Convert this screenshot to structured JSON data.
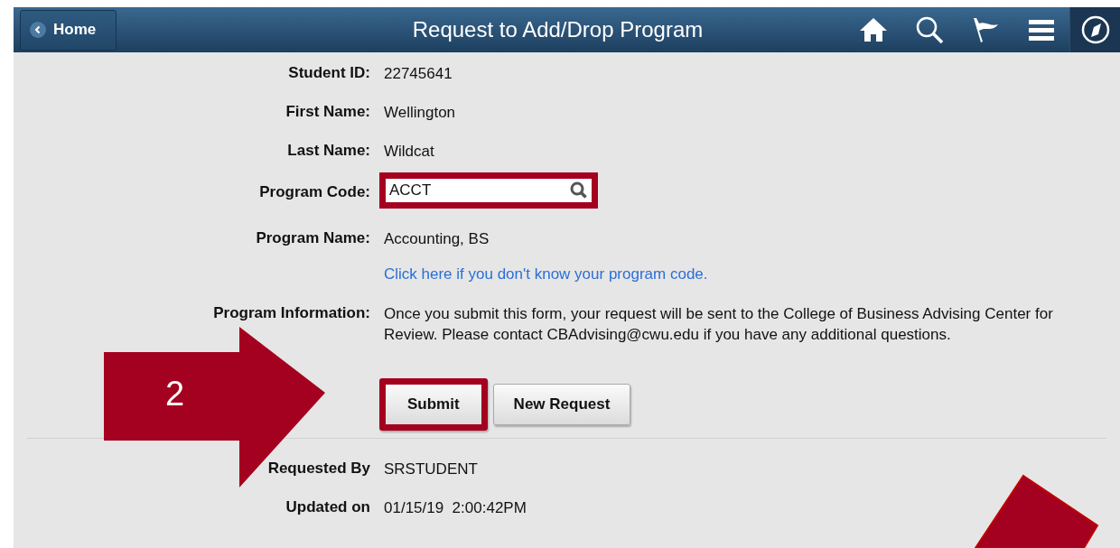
{
  "header": {
    "back_button": "Home",
    "title": "Request to Add/Drop Program"
  },
  "fields": [
    {
      "kind": "text",
      "label": "Student ID:",
      "value": "22745641"
    },
    {
      "kind": "text",
      "label": "First Name:",
      "value": "Wellington"
    },
    {
      "kind": "text",
      "label": "Last Name:",
      "value": "Wildcat"
    },
    {
      "kind": "input",
      "label": "Program Code:",
      "value": "ACCT",
      "highlighted": true
    },
    {
      "kind": "text",
      "label": "Program Name:",
      "value": "Accounting, BS"
    },
    {
      "kind": "link",
      "value": "Click here if you don't know your program code."
    },
    {
      "kind": "text",
      "label": "Program Information:",
      "value": "Once you submit this form, your request will be sent to the College of Business Advising Center for Review. Please contact CBAdvising@cwu.edu if you have any additional questions."
    }
  ],
  "buttons": [
    {
      "label": "Submit",
      "highlighted": true
    },
    {
      "label": "New Request",
      "highlighted": false
    }
  ],
  "audit": [
    {
      "label": "Requested By",
      "value": "SRSTUDENT"
    },
    {
      "label": "Updated on",
      "value": "01/15/19  2:00:42PM"
    }
  ],
  "annotation": {
    "step": "2"
  }
}
